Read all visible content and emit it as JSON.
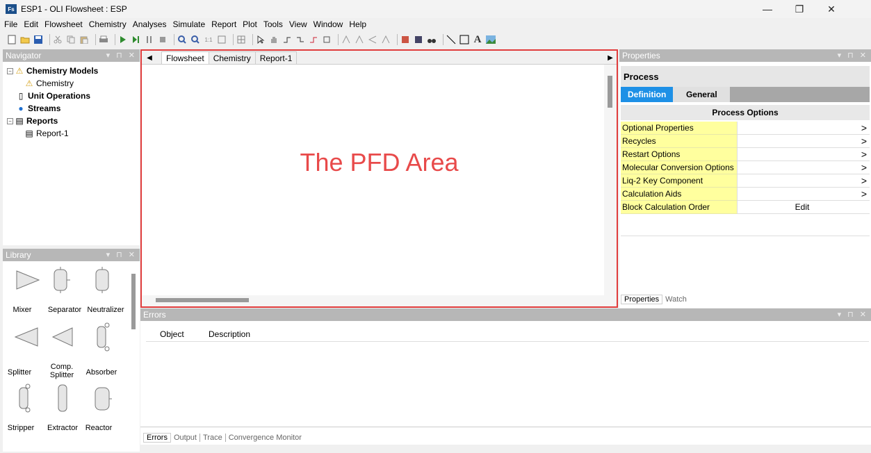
{
  "window": {
    "app_icon": "Fs",
    "title": "ESP1 - OLI Flowsheet : ESP",
    "minimize": "—",
    "restore": "❐",
    "close": "✕"
  },
  "menu": [
    {
      "label": "File"
    },
    {
      "label": "Edit"
    },
    {
      "label": "Flowsheet"
    },
    {
      "label": "Chemistry"
    },
    {
      "label": "Analyses"
    },
    {
      "label": "Simulate"
    },
    {
      "label": "Report"
    },
    {
      "label": "Plot"
    },
    {
      "label": "Tools"
    },
    {
      "label": "View"
    },
    {
      "label": "Window"
    },
    {
      "label": "Help"
    }
  ],
  "navigator": {
    "title": "Navigator",
    "items": [
      {
        "label": "Chemistry Models"
      },
      {
        "label": "Chemistry"
      },
      {
        "label": "Unit Operations"
      },
      {
        "label": "Streams"
      },
      {
        "label": "Reports"
      },
      {
        "label": "Report-1"
      }
    ]
  },
  "library": {
    "title": "Library",
    "items": [
      {
        "label": "Mixer"
      },
      {
        "label": "Separator"
      },
      {
        "label": "Neutralizer"
      },
      {
        "label": "Splitter"
      },
      {
        "label": "Comp. Splitter"
      },
      {
        "label": "Absorber"
      },
      {
        "label": "Stripper"
      },
      {
        "label": "Extractor"
      },
      {
        "label": "Reactor"
      }
    ]
  },
  "pfd": {
    "tabs": [
      {
        "label": "Flowsheet"
      },
      {
        "label": "Chemistry"
      },
      {
        "label": "Report-1"
      }
    ],
    "area_label": "The PFD Area"
  },
  "errors": {
    "title": "Errors",
    "columns": [
      "Object",
      "Description"
    ],
    "bottom_tabs": [
      {
        "label": "Errors"
      },
      {
        "label": "Output"
      },
      {
        "label": "Trace"
      },
      {
        "label": "Convergence Monitor"
      }
    ]
  },
  "properties": {
    "title": "Properties",
    "section": "Process",
    "tabs": [
      {
        "label": "Definition"
      },
      {
        "label": "General"
      }
    ],
    "group": "Process Options",
    "rows": [
      {
        "label": "Optional Properties",
        "value": ">"
      },
      {
        "label": "Recycles",
        "value": ">"
      },
      {
        "label": "Restart Options",
        "value": ">"
      },
      {
        "label": "Molecular Conversion Options",
        "value": ">"
      },
      {
        "label": "Liq-2 Key Component",
        "value": ">"
      },
      {
        "label": "Calculation Aids",
        "value": ">"
      },
      {
        "label": "Block Calculation Order",
        "value": "Edit"
      }
    ],
    "bottom_tabs": [
      {
        "label": "Properties"
      },
      {
        "label": "Watch"
      }
    ]
  },
  "colors": {
    "pfd_border": "#e03c3c",
    "pfd_label": "#e84a4a",
    "active_tab": "#1e90e6",
    "property_label_bg": "#ffff9e"
  }
}
